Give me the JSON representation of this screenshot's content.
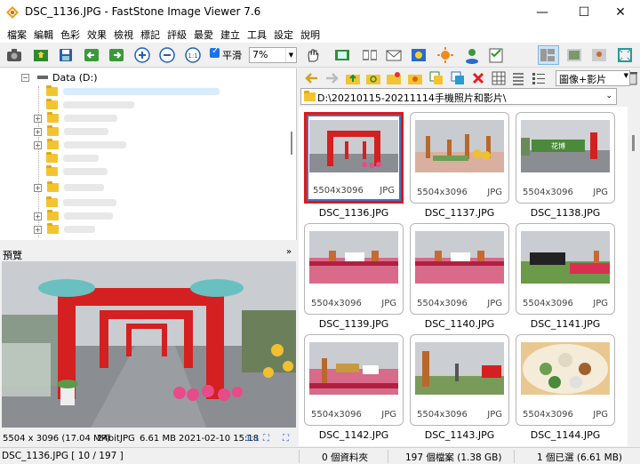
{
  "window": {
    "title": "DSC_1136.JPG  -  FastStone Image Viewer 7.6",
    "minimize": "—",
    "maximize": "☐",
    "close": "✕"
  },
  "menu": [
    "檔案",
    "編輯",
    "色彩",
    "效果",
    "檢視",
    "標記",
    "評級",
    "最愛",
    "建立",
    "工具",
    "設定",
    "說明"
  ],
  "toolbar": {
    "smooth_label": "平滑",
    "smooth_checked": true,
    "zoom_value": "7%"
  },
  "tree": {
    "root_label": "Data (D:)"
  },
  "preview": {
    "title": "預覽",
    "info": {
      "dimensions": "5504 x 3096 (17.04 MP)",
      "bitdepth": "24bit",
      "format": "JPG",
      "size": "6.61 MB",
      "datetime": "2021-02-10 15:18",
      "ratio": "1:1"
    }
  },
  "browser": {
    "view_mode": "圖像+影片",
    "path": "D:\\20210115-20211114手機照片和影片\\",
    "thumbnails": [
      {
        "name": "DSC_1136.JPG",
        "dims": "5504x3096",
        "format": "JPG",
        "selected": true,
        "scene": "arches"
      },
      {
        "name": "DSC_1137.JPG",
        "dims": "5504x3096",
        "format": "JPG",
        "selected": false,
        "scene": "garden"
      },
      {
        "name": "DSC_1138.JPG",
        "dims": "5504x3096",
        "format": "JPG",
        "selected": false,
        "scene": "sign"
      },
      {
        "name": "DSC_1139.JPG",
        "dims": "5504x3096",
        "format": "JPG",
        "selected": false,
        "scene": "flowers"
      },
      {
        "name": "DSC_1140.JPG",
        "dims": "5504x3096",
        "format": "JPG",
        "selected": false,
        "scene": "flowers"
      },
      {
        "name": "DSC_1141.JPG",
        "dims": "5504x3096",
        "format": "JPG",
        "selected": false,
        "scene": "train"
      },
      {
        "name": "DSC_1142.JPG",
        "dims": "5504x3096",
        "format": "JPG",
        "selected": false,
        "scene": "flowers2"
      },
      {
        "name": "DSC_1143.JPG",
        "dims": "5504x3096",
        "format": "JPG",
        "selected": false,
        "scene": "tower"
      },
      {
        "name": "DSC_1144.JPG",
        "dims": "5504x3096",
        "format": "JPG",
        "selected": false,
        "scene": "food"
      }
    ]
  },
  "status": {
    "current": "DSC_1136.JPG [ 10 / 197 ]",
    "folders": "0 個資料夾",
    "files": "197 個檔案 (1.38 GB)",
    "selected": "1 個已選 (6.61 MB)"
  },
  "colors": {
    "selection": "#e01818",
    "accent": "#1a73e8",
    "folder": "#f4c430"
  }
}
